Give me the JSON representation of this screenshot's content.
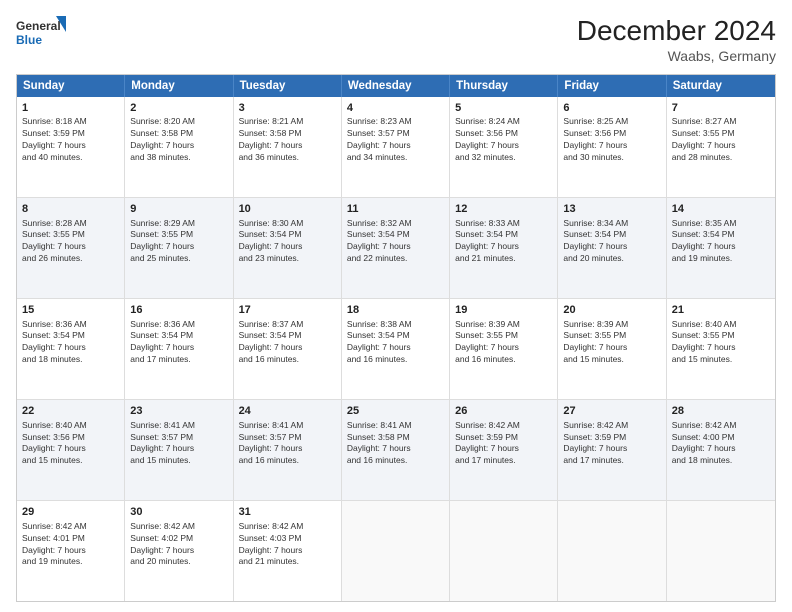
{
  "logo": {
    "line1": "General",
    "line2": "Blue"
  },
  "title": "December 2024",
  "subtitle": "Waabs, Germany",
  "header_days": [
    "Sunday",
    "Monday",
    "Tuesday",
    "Wednesday",
    "Thursday",
    "Friday",
    "Saturday"
  ],
  "weeks": [
    [
      {
        "day": "1",
        "info": "Sunrise: 8:18 AM\nSunset: 3:59 PM\nDaylight: 7 hours\nand 40 minutes."
      },
      {
        "day": "2",
        "info": "Sunrise: 8:20 AM\nSunset: 3:58 PM\nDaylight: 7 hours\nand 38 minutes."
      },
      {
        "day": "3",
        "info": "Sunrise: 8:21 AM\nSunset: 3:58 PM\nDaylight: 7 hours\nand 36 minutes."
      },
      {
        "day": "4",
        "info": "Sunrise: 8:23 AM\nSunset: 3:57 PM\nDaylight: 7 hours\nand 34 minutes."
      },
      {
        "day": "5",
        "info": "Sunrise: 8:24 AM\nSunset: 3:56 PM\nDaylight: 7 hours\nand 32 minutes."
      },
      {
        "day": "6",
        "info": "Sunrise: 8:25 AM\nSunset: 3:56 PM\nDaylight: 7 hours\nand 30 minutes."
      },
      {
        "day": "7",
        "info": "Sunrise: 8:27 AM\nSunset: 3:55 PM\nDaylight: 7 hours\nand 28 minutes."
      }
    ],
    [
      {
        "day": "8",
        "info": "Sunrise: 8:28 AM\nSunset: 3:55 PM\nDaylight: 7 hours\nand 26 minutes."
      },
      {
        "day": "9",
        "info": "Sunrise: 8:29 AM\nSunset: 3:55 PM\nDaylight: 7 hours\nand 25 minutes."
      },
      {
        "day": "10",
        "info": "Sunrise: 8:30 AM\nSunset: 3:54 PM\nDaylight: 7 hours\nand 23 minutes."
      },
      {
        "day": "11",
        "info": "Sunrise: 8:32 AM\nSunset: 3:54 PM\nDaylight: 7 hours\nand 22 minutes."
      },
      {
        "day": "12",
        "info": "Sunrise: 8:33 AM\nSunset: 3:54 PM\nDaylight: 7 hours\nand 21 minutes."
      },
      {
        "day": "13",
        "info": "Sunrise: 8:34 AM\nSunset: 3:54 PM\nDaylight: 7 hours\nand 20 minutes."
      },
      {
        "day": "14",
        "info": "Sunrise: 8:35 AM\nSunset: 3:54 PM\nDaylight: 7 hours\nand 19 minutes."
      }
    ],
    [
      {
        "day": "15",
        "info": "Sunrise: 8:36 AM\nSunset: 3:54 PM\nDaylight: 7 hours\nand 18 minutes."
      },
      {
        "day": "16",
        "info": "Sunrise: 8:36 AM\nSunset: 3:54 PM\nDaylight: 7 hours\nand 17 minutes."
      },
      {
        "day": "17",
        "info": "Sunrise: 8:37 AM\nSunset: 3:54 PM\nDaylight: 7 hours\nand 16 minutes."
      },
      {
        "day": "18",
        "info": "Sunrise: 8:38 AM\nSunset: 3:54 PM\nDaylight: 7 hours\nand 16 minutes."
      },
      {
        "day": "19",
        "info": "Sunrise: 8:39 AM\nSunset: 3:55 PM\nDaylight: 7 hours\nand 16 minutes."
      },
      {
        "day": "20",
        "info": "Sunrise: 8:39 AM\nSunset: 3:55 PM\nDaylight: 7 hours\nand 15 minutes."
      },
      {
        "day": "21",
        "info": "Sunrise: 8:40 AM\nSunset: 3:55 PM\nDaylight: 7 hours\nand 15 minutes."
      }
    ],
    [
      {
        "day": "22",
        "info": "Sunrise: 8:40 AM\nSunset: 3:56 PM\nDaylight: 7 hours\nand 15 minutes."
      },
      {
        "day": "23",
        "info": "Sunrise: 8:41 AM\nSunset: 3:57 PM\nDaylight: 7 hours\nand 15 minutes."
      },
      {
        "day": "24",
        "info": "Sunrise: 8:41 AM\nSunset: 3:57 PM\nDaylight: 7 hours\nand 16 minutes."
      },
      {
        "day": "25",
        "info": "Sunrise: 8:41 AM\nSunset: 3:58 PM\nDaylight: 7 hours\nand 16 minutes."
      },
      {
        "day": "26",
        "info": "Sunrise: 8:42 AM\nSunset: 3:59 PM\nDaylight: 7 hours\nand 17 minutes."
      },
      {
        "day": "27",
        "info": "Sunrise: 8:42 AM\nSunset: 3:59 PM\nDaylight: 7 hours\nand 17 minutes."
      },
      {
        "day": "28",
        "info": "Sunrise: 8:42 AM\nSunset: 4:00 PM\nDaylight: 7 hours\nand 18 minutes."
      }
    ],
    [
      {
        "day": "29",
        "info": "Sunrise: 8:42 AM\nSunset: 4:01 PM\nDaylight: 7 hours\nand 19 minutes."
      },
      {
        "day": "30",
        "info": "Sunrise: 8:42 AM\nSunset: 4:02 PM\nDaylight: 7 hours\nand 20 minutes."
      },
      {
        "day": "31",
        "info": "Sunrise: 8:42 AM\nSunset: 4:03 PM\nDaylight: 7 hours\nand 21 minutes."
      },
      {
        "day": "",
        "info": ""
      },
      {
        "day": "",
        "info": ""
      },
      {
        "day": "",
        "info": ""
      },
      {
        "day": "",
        "info": ""
      }
    ]
  ]
}
